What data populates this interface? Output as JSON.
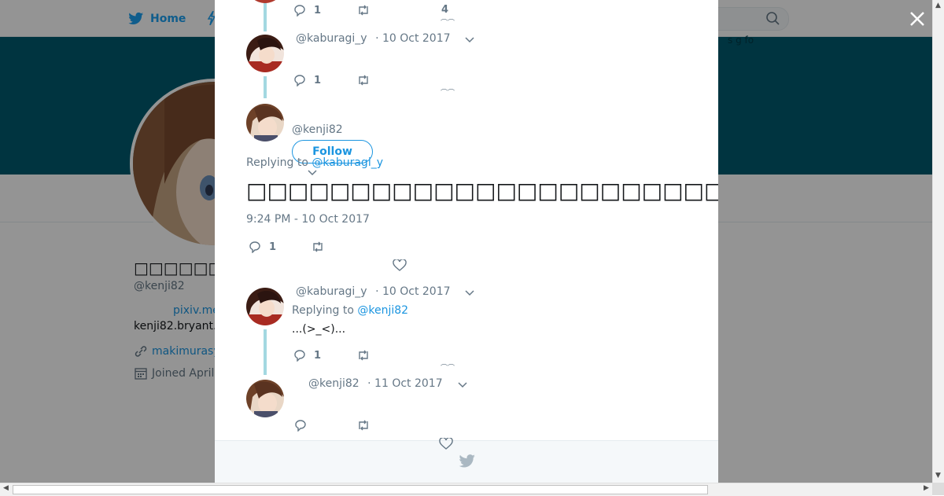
{
  "topnav": {
    "home_label": "Home"
  },
  "profile": {
    "name": "□□□□□□□□□□",
    "handle": "@kenji82",
    "bio_link": "pixiv.me",
    "bio_text": "kenji82.bryant.",
    "url": "makimurasy",
    "joined": "Joined April"
  },
  "background_right_text": "s  g  fo",
  "thread": {
    "top_tweet": {
      "reply_count": "1",
      "like_count": "4"
    },
    "tweet1": {
      "handle": "@kaburagi_y",
      "date": "· 10 Oct 2017",
      "reply_count": "1"
    },
    "focused": {
      "handle": "@kenji82",
      "follow_label": "Follow",
      "replying_prefix": "Replying to",
      "replying_to": "@kaburagi_y",
      "text": "□□□□□□□□□□□□□□□□□□□□□□□□□□□□□□□□□□□□□□□□□□□□□□□□□□□□□□□□□□□□",
      "timestamp": "9:24 PM - 10 Oct 2017",
      "reply_count": "1"
    },
    "tweet2": {
      "handle": "@kaburagi_y",
      "date": "· 10 Oct 2017",
      "replying_prefix": "Replying to",
      "replying_to": "@kenji82",
      "text": "...(>_<)...",
      "reply_count": "1"
    },
    "tweet3": {
      "handle": "@kenji82",
      "date": "· 11 Oct 2017"
    }
  },
  "colors": {
    "accent": "#1b95e0",
    "banner": "#005a6e",
    "thread_line": "#a3d8e1",
    "muted": "#657786"
  },
  "icons": [
    "twitter-bird-icon",
    "search-icon",
    "close-icon",
    "reply-icon",
    "retweet-icon",
    "heart-icon",
    "chevron-down-icon",
    "link-icon",
    "calendar-icon"
  ]
}
